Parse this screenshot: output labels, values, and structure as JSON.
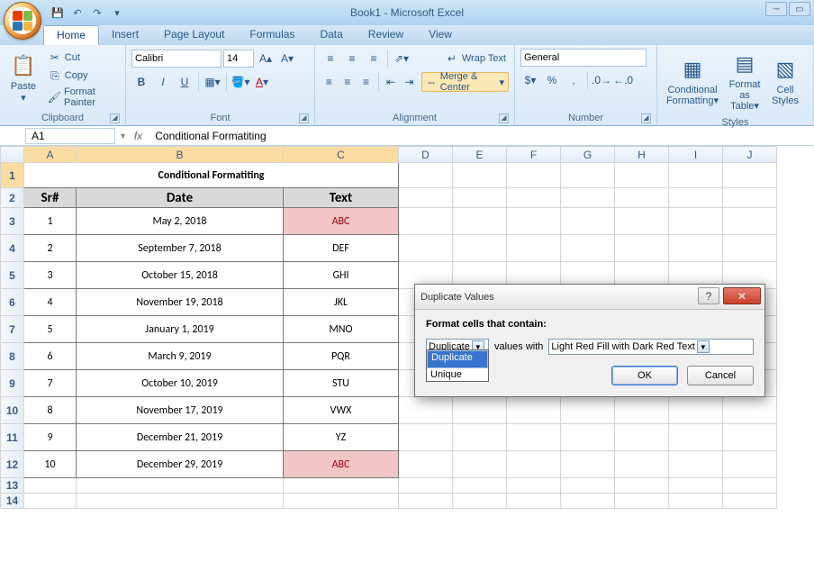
{
  "app": {
    "title": "Book1 - Microsoft Excel"
  },
  "qat": {
    "save": "💾",
    "undo": "↶",
    "redo": "↷",
    "more": "▾"
  },
  "tabs": [
    "Home",
    "Insert",
    "Page Layout",
    "Formulas",
    "Data",
    "Review",
    "View"
  ],
  "ribbon": {
    "clipboard": {
      "paste": "Paste",
      "cut": "Cut",
      "copy": "Copy",
      "fp": "Format Painter",
      "label": "Clipboard"
    },
    "font": {
      "name": "Calibri",
      "size": "14",
      "bold": "B",
      "italic": "I",
      "underline": "U",
      "label": "Font"
    },
    "alignment": {
      "wrap": "Wrap Text",
      "merge": "Merge & Center",
      "label": "Alignment"
    },
    "number": {
      "format": "General",
      "label": "Number"
    },
    "styles": {
      "cf": "Conditional Formatting",
      "fat": "Format as Table",
      "cs": "Cell Styles",
      "label": "Styles"
    }
  },
  "namebox": "A1",
  "formula": "Conditional Formatiting",
  "columns": [
    "A",
    "B",
    "C",
    "D",
    "E",
    "F",
    "G",
    "H",
    "I",
    "J"
  ],
  "content": {
    "title": "Conditional Formatiting",
    "headers": [
      "Sr#",
      "Date",
      "Text"
    ],
    "rows": [
      {
        "n": "1",
        "date": "May 2, 2018",
        "text": "ABC",
        "hl": true
      },
      {
        "n": "2",
        "date": "September 7, 2018",
        "text": "DEF",
        "hl": false
      },
      {
        "n": "3",
        "date": "October 15, 2018",
        "text": "GHI",
        "hl": false
      },
      {
        "n": "4",
        "date": "November 19, 2018",
        "text": "JKL",
        "hl": false
      },
      {
        "n": "5",
        "date": "January 1, 2019",
        "text": "MNO",
        "hl": false
      },
      {
        "n": "6",
        "date": "March 9, 2019",
        "text": "PQR",
        "hl": false
      },
      {
        "n": "7",
        "date": "October 10, 2019",
        "text": "STU",
        "hl": false
      },
      {
        "n": "8",
        "date": "November 17, 2019",
        "text": "VWX",
        "hl": false
      },
      {
        "n": "9",
        "date": "December 21, 2019",
        "text": "YZ",
        "hl": false
      },
      {
        "n": "10",
        "date": "December 29, 2019",
        "text": "ABC",
        "hl": true
      }
    ]
  },
  "dialog": {
    "title": "Duplicate Values",
    "heading": "Format cells that contain:",
    "comboValue": "Duplicate",
    "middleText": "values with",
    "formatValue": "Light Red Fill with Dark Red Text",
    "options": [
      "Duplicate",
      "Unique"
    ],
    "ok": "OK",
    "cancel": "Cancel"
  }
}
